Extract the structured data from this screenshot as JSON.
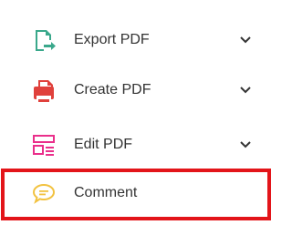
{
  "tools": [
    {
      "label": "Export PDF",
      "icon": "export-pdf-icon",
      "color": "#3aa88b",
      "expandable": true
    },
    {
      "label": "Create PDF",
      "icon": "create-pdf-icon",
      "color": "#e0413c",
      "expandable": true
    },
    {
      "label": "Edit PDF",
      "icon": "edit-pdf-icon",
      "color": "#ea2f8b",
      "expandable": true
    },
    {
      "label": "Comment",
      "icon": "comment-icon",
      "color": "#f2c240",
      "expandable": false,
      "highlighted": true
    }
  ],
  "highlight_color": "#e3151a"
}
